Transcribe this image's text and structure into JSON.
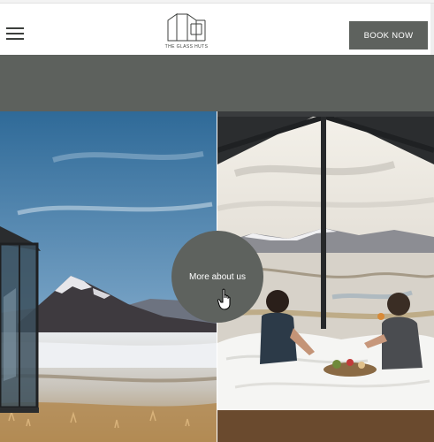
{
  "header": {
    "menu_icon": "hamburger-menu-icon",
    "logo_text": "THE GLASS HUTS",
    "book_button": "BOOK NOW"
  },
  "hero": {
    "more_button": "More about us",
    "cursor_icon": "hand-pointer-icon"
  },
  "colors": {
    "brand_gray": "#5e625e",
    "band_gray": "#5d615d",
    "text_dark": "#3c3f3c"
  }
}
